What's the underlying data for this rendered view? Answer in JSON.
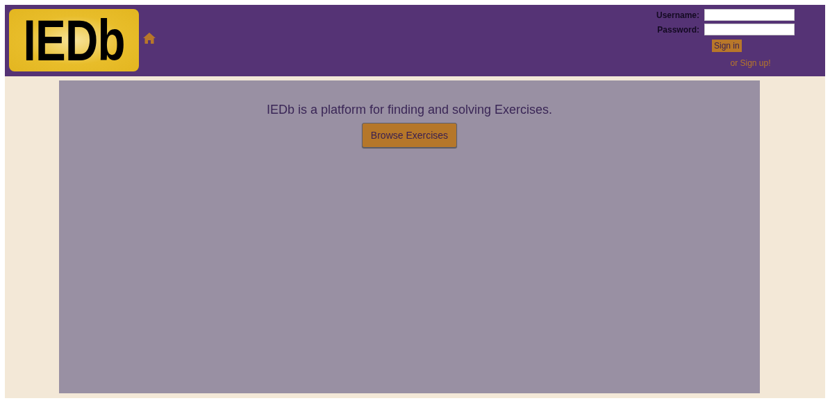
{
  "header": {
    "logo": "IEDb",
    "login": {
      "username_label": "Username:",
      "password_label": "Password:",
      "sign_in": "Sign in",
      "sign_up": "or Sign up!"
    }
  },
  "main": {
    "intro": "IEDb is a platform for finding and solving Exercises.",
    "browse_button": "Browse Exercises"
  }
}
